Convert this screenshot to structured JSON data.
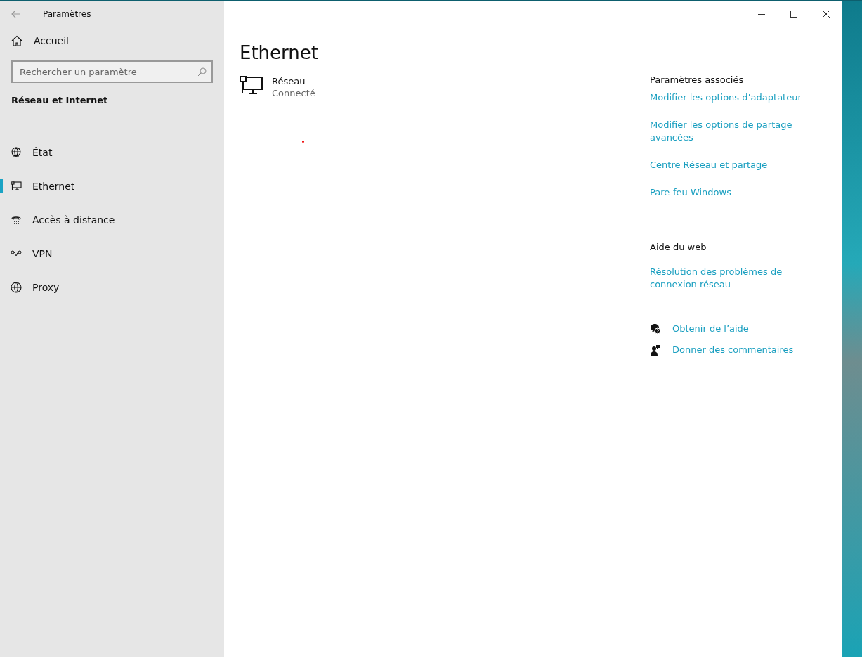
{
  "window": {
    "title": "Paramètres"
  },
  "sidebar": {
    "home": "Accueil",
    "search": {
      "placeholder": "Rechercher un paramètre"
    },
    "section": "Réseau et Internet",
    "items": [
      {
        "label": "État",
        "kind": "status",
        "selected": false
      },
      {
        "label": "Ethernet",
        "kind": "ethernet",
        "selected": true
      },
      {
        "label": "Accès à distance",
        "kind": "dialup",
        "selected": false
      },
      {
        "label": "VPN",
        "kind": "vpn",
        "selected": false
      },
      {
        "label": "Proxy",
        "kind": "proxy",
        "selected": false
      }
    ]
  },
  "main": {
    "title": "Ethernet",
    "network": {
      "name": "Réseau",
      "status": "Connecté"
    }
  },
  "related": {
    "heading": "Paramètres associés",
    "links": [
      "Modifier les options d’adaptateur",
      "Modifier les options de partage avancées",
      "Centre Réseau et partage",
      "Pare-feu Windows"
    ]
  },
  "web_help": {
    "heading": "Aide du web",
    "links": [
      "Résolution des problèmes de connexion réseau"
    ]
  },
  "support": [
    {
      "kind": "help",
      "label": "Obtenir de l’aide"
    },
    {
      "kind": "feedback",
      "label": "Donner des commentaires"
    }
  ]
}
